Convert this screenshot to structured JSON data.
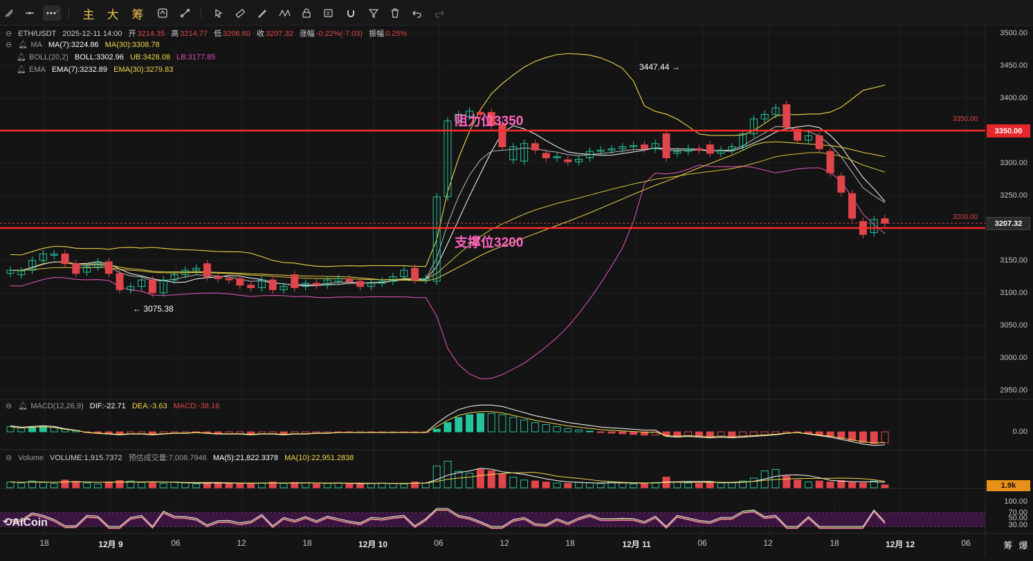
{
  "toolbar": {
    "tools": [
      "diagonal-line-icon",
      "horizontal-line-icon",
      "more-icon"
    ],
    "text_buttons": [
      "主",
      "大",
      "筹"
    ],
    "icons": [
      "sync-icon",
      "ruler-line-icon",
      "brush-icon",
      "pattern-icon",
      "lock-icon",
      "edit-icon",
      "magnet-icon",
      "filter-icon",
      "trash-icon",
      "undo-icon",
      "redo-icon"
    ]
  },
  "header": {
    "symbol": "ETH/USDT",
    "datetime": "2025-12-11 14:00",
    "open_label": "开",
    "open": "3214.35",
    "high_label": "高",
    "high": "3214.77",
    "low_label": "低",
    "low": "3206.60",
    "close_label": "收",
    "close": "3207.32",
    "change_label": "涨幅",
    "change": "-0.22%(-7.03)",
    "amp_label": "振幅",
    "amp": "0.25%"
  },
  "indicators": {
    "ma": {
      "name": "MA",
      "ma7": "MA(7):3224.86",
      "ma30": "MA(30):3308.78"
    },
    "boll": {
      "name": "BOLL(20,2)",
      "boll": "BOLL:3302.96",
      "ub": "UB:3428.08",
      "lb": "LB:3177.85"
    },
    "ema": {
      "name": "EMA",
      "ema7": "EMA(7):3232.89",
      "ema30": "EMA(30):3279.83"
    },
    "macd": {
      "name": "MACD(12,26,9)",
      "dif": "DIF:-22.71",
      "dea": "DEA:-3.63",
      "macd": "MACD:-38.16"
    },
    "volume": {
      "name": "Volume",
      "volume": "VOLUME:1,915.7372",
      "est": "预估成交量:7,008.7946",
      "ma5": "MA(5):21,822.3378",
      "ma10": "MA(10):22,951.2838"
    }
  },
  "annotations": {
    "resistance": "阻力位3350",
    "support": "支撑位3200",
    "high_marker": "3447.44 →",
    "low_marker": "← 3075.38"
  },
  "price_axis": [
    "3500.00",
    "3450.00",
    "3400.00",
    "3350.00",
    "3300.00",
    "3250.00",
    "3200.00",
    "3150.00",
    "3100.00",
    "3050.00",
    "3000.00",
    "2950.00"
  ],
  "price_tags": {
    "resistance_small": "3350.00",
    "resistance_tag": "3350.00",
    "support_small": "3200.00",
    "current_tag": "3207.32"
  },
  "macd_axis": [
    "0.00"
  ],
  "volume_tag": "1.9k",
  "rsi_axis": [
    "100.00",
    "70.00",
    "50.00",
    "30.00"
  ],
  "time_axis": [
    {
      "label": "18",
      "bold": false
    },
    {
      "label": "12月 9",
      "bold": true
    },
    {
      "label": "06",
      "bold": false
    },
    {
      "label": "12",
      "bold": false
    },
    {
      "label": "18",
      "bold": false
    },
    {
      "label": "12月 10",
      "bold": true
    },
    {
      "label": "06",
      "bold": false
    },
    {
      "label": "12",
      "bold": false
    },
    {
      "label": "18",
      "bold": false
    },
    {
      "label": "12月 11",
      "bold": true
    },
    {
      "label": "06",
      "bold": false
    },
    {
      "label": "12",
      "bold": false
    },
    {
      "label": "18",
      "bold": false
    },
    {
      "label": "12月 12",
      "bold": true
    },
    {
      "label": "06",
      "bold": false
    }
  ],
  "bottom_right": [
    "筹",
    "爆"
  ],
  "logo": "AiCoin",
  "colors": {
    "up": "#26c49a",
    "down": "#e0454b",
    "resistance": "#ff2a2a",
    "ma7": "#ffffff",
    "ma30": "#f0d84a",
    "lb": "#d84fb5",
    "annotation": "#ff63c1",
    "volume_tag": "#e8901a"
  },
  "chart_data": {
    "type": "candlestick",
    "symbol": "ETH/USDT",
    "interval": "1h",
    "ylim": [
      2925,
      3515
    ],
    "horizontal_lines": [
      3350,
      3200
    ],
    "candles": [
      {
        "o": 3130,
        "c": 3135
      },
      {
        "o": 3128,
        "c": 3134
      },
      {
        "o": 3135,
        "c": 3150
      },
      {
        "o": 3150,
        "c": 3160
      },
      {
        "o": 3158,
        "c": 3160
      },
      {
        "o": 3160,
        "c": 3145
      },
      {
        "o": 3145,
        "c": 3130
      },
      {
        "o": 3132,
        "c": 3140
      },
      {
        "o": 3140,
        "c": 3148
      },
      {
        "o": 3148,
        "c": 3130
      },
      {
        "o": 3130,
        "c": 3105
      },
      {
        "o": 3105,
        "c": 3110
      },
      {
        "o": 3110,
        "c": 3120
      },
      {
        "o": 3120,
        "c": 3100
      },
      {
        "o": 3100,
        "c": 3120
      },
      {
        "o": 3120,
        "c": 3128
      },
      {
        "o": 3128,
        "c": 3135
      },
      {
        "o": 3135,
        "c": 3138
      },
      {
        "o": 3145,
        "c": 3125
      },
      {
        "o": 3125,
        "c": 3122
      },
      {
        "o": 3122,
        "c": 3120
      },
      {
        "o": 3122,
        "c": 3112
      },
      {
        "o": 3112,
        "c": 3108
      },
      {
        "o": 3108,
        "c": 3120
      },
      {
        "o": 3120,
        "c": 3105
      },
      {
        "o": 3105,
        "c": 3110
      },
      {
        "o": 3128,
        "c": 3108
      },
      {
        "o": 3110,
        "c": 3115
      },
      {
        "o": 3115,
        "c": 3112
      },
      {
        "o": 3112,
        "c": 3120
      },
      {
        "o": 3118,
        "c": 3122
      },
      {
        "o": 3122,
        "c": 3118
      },
      {
        "o": 3118,
        "c": 3110
      },
      {
        "o": 3110,
        "c": 3115
      },
      {
        "o": 3115,
        "c": 3118
      },
      {
        "o": 3118,
        "c": 3125
      },
      {
        "o": 3125,
        "c": 3135
      },
      {
        "o": 3138,
        "c": 3120
      },
      {
        "o": 3120,
        "c": 3122
      },
      {
        "o": 3118,
        "c": 3248
      },
      {
        "o": 3248,
        "c": 3365
      },
      {
        "o": 3365,
        "c": 3375
      },
      {
        "o": 3372,
        "c": 3380
      },
      {
        "o": 3378,
        "c": 3375
      },
      {
        "o": 3378,
        "c": 3358
      },
      {
        "o": 3360,
        "c": 3325
      },
      {
        "o": 3305,
        "c": 3325
      },
      {
        "o": 3303,
        "c": 3330
      },
      {
        "o": 3330,
        "c": 3320
      },
      {
        "o": 3315,
        "c": 3308
      },
      {
        "o": 3308,
        "c": 3310
      },
      {
        "o": 3305,
        "c": 3302
      },
      {
        "o": 3302,
        "c": 3306
      },
      {
        "o": 3308,
        "c": 3318
      },
      {
        "o": 3318,
        "c": 3320
      },
      {
        "o": 3320,
        "c": 3322
      },
      {
        "o": 3322,
        "c": 3325
      },
      {
        "o": 3325,
        "c": 3327
      },
      {
        "o": 3328,
        "c": 3322
      },
      {
        "o": 3322,
        "c": 3330
      },
      {
        "o": 3345,
        "c": 3308
      },
      {
        "o": 3315,
        "c": 3318
      },
      {
        "o": 3318,
        "c": 3322
      },
      {
        "o": 3322,
        "c": 3320
      },
      {
        "o": 3328,
        "c": 3315
      },
      {
        "o": 3315,
        "c": 3320
      },
      {
        "o": 3320,
        "c": 3325
      },
      {
        "o": 3325,
        "c": 3345
      },
      {
        "o": 3345,
        "c": 3368
      },
      {
        "o": 3368,
        "c": 3375
      },
      {
        "o": 3375,
        "c": 3385
      },
      {
        "o": 3390,
        "c": 3355
      },
      {
        "o": 3352,
        "c": 3335
      },
      {
        "o": 3335,
        "c": 3342
      },
      {
        "o": 3342,
        "c": 3322
      },
      {
        "o": 3318,
        "c": 3285
      },
      {
        "o": 3280,
        "c": 3255
      },
      {
        "o": 3253,
        "c": 3215
      },
      {
        "o": 3210,
        "c": 3190
      },
      {
        "o": 3193,
        "c": 3213
      },
      {
        "o": 3214.35,
        "c": 3207.32
      }
    ],
    "macd_hist": [
      8,
      6,
      7,
      8,
      7,
      4,
      2,
      -1,
      -2,
      -3,
      -4,
      -3,
      -3,
      -4,
      -3,
      -2,
      -2,
      -1,
      -2,
      -3,
      -3,
      -3,
      -4,
      -3,
      -3,
      -4,
      -3,
      -3,
      -2,
      -2,
      -1,
      -1,
      -1,
      -1,
      -1,
      -1,
      -1,
      -1,
      -1,
      4,
      14,
      22,
      26,
      28,
      28,
      26,
      22,
      18,
      14,
      11,
      8,
      5,
      3,
      1,
      -1,
      -2,
      -3,
      -4,
      -5,
      -5,
      -6,
      -7,
      -6,
      -7,
      -8,
      -7,
      -8,
      -7,
      -6,
      -5,
      -4,
      -2,
      -1,
      -3,
      -5,
      -7,
      -10,
      -13,
      -16,
      -18,
      -17
    ],
    "volume": [
      12,
      10,
      14,
      11,
      9,
      16,
      13,
      10,
      8,
      12,
      15,
      14,
      11,
      10,
      9,
      12,
      10,
      8,
      9,
      11,
      10,
      9,
      8,
      10,
      12,
      9,
      11,
      10,
      8,
      9,
      10,
      9,
      8,
      9,
      10,
      9,
      8,
      12,
      10,
      45,
      55,
      34,
      30,
      38,
      35,
      28,
      22,
      16,
      14,
      12,
      10,
      9,
      11,
      10,
      9,
      12,
      10,
      8,
      9,
      11,
      22,
      12,
      10,
      9,
      12,
      10,
      11,
      14,
      20,
      35,
      38,
      24,
      16,
      12,
      14,
      12,
      15,
      11,
      10,
      14,
      6
    ]
  }
}
